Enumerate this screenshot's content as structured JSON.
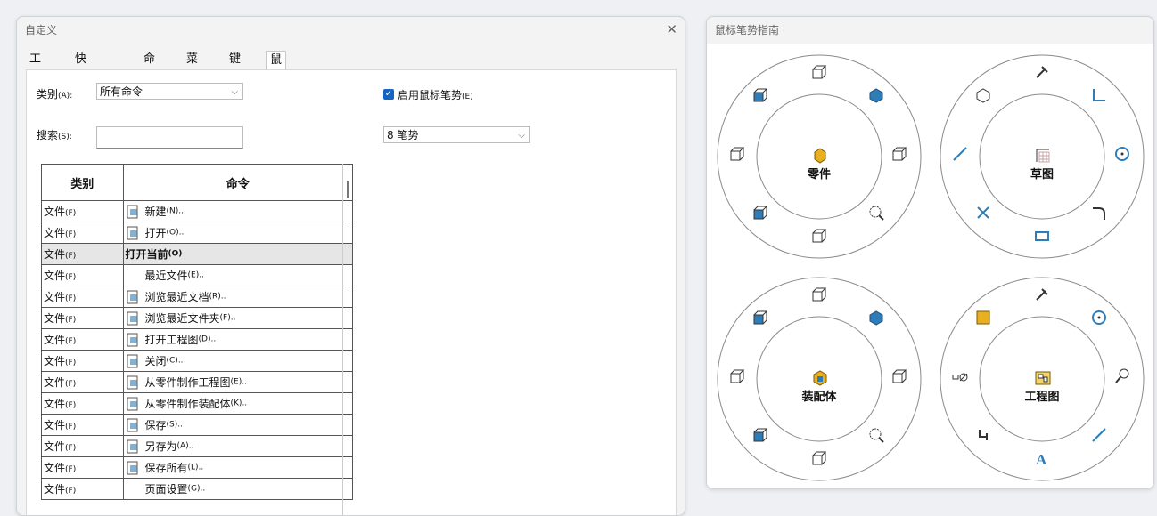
{
  "customize": {
    "title": "自定义",
    "tabs": [
      "工具栏",
      "快捷方式栏",
      "命令",
      "菜单",
      "键盘",
      "鼠标笔势"
    ],
    "category_label": "类别",
    "category_hotkey": "(A):",
    "category_value": "所有命令",
    "search_label": "搜索",
    "search_hotkey": "(S):",
    "search_value": "",
    "enable_gesture_label": "启用鼠标笔势",
    "enable_gesture_hotkey": "(E)",
    "enable_gesture_checked": true,
    "gesture_count_value": "8 笔势",
    "table": {
      "headers": [
        "类别",
        "命令"
      ],
      "rows": [
        {
          "cat": "文件",
          "cat_hk": "(F)",
          "icon": "new-document-icon",
          "cmd": "新建",
          "cmd_hk": "(N)..",
          "bold": false
        },
        {
          "cat": "文件",
          "cat_hk": "(F)",
          "icon": "open-folder-icon",
          "cmd": "打开",
          "cmd_hk": "(O)..",
          "bold": false
        },
        {
          "cat": "文件",
          "cat_hk": "(F)",
          "icon": "",
          "cmd": "打开当前",
          "cmd_hk": "(O)",
          "bold": true
        },
        {
          "cat": "文件",
          "cat_hk": "(F)",
          "icon": "",
          "cmd": "最近文件",
          "cmd_hk": "(E)..",
          "bold": false
        },
        {
          "cat": "文件",
          "cat_hk": "(F)",
          "icon": "browse-recent-docs-icon",
          "cmd": "浏览最近文档",
          "cmd_hk": "(R)..",
          "bold": false
        },
        {
          "cat": "文件",
          "cat_hk": "(F)",
          "icon": "browse-recent-folders-icon",
          "cmd": "浏览最近文件夹",
          "cmd_hk": "(F)..",
          "bold": false
        },
        {
          "cat": "文件",
          "cat_hk": "(F)",
          "icon": "open-drawing-icon",
          "cmd": "打开工程图",
          "cmd_hk": "(D)..",
          "bold": false
        },
        {
          "cat": "文件",
          "cat_hk": "(F)",
          "icon": "close-document-icon",
          "cmd": "关闭",
          "cmd_hk": "(C)..",
          "bold": false
        },
        {
          "cat": "文件",
          "cat_hk": "(F)",
          "icon": "make-drawing-icon",
          "cmd": "从零件制作工程图",
          "cmd_hk": "(E)..",
          "bold": false
        },
        {
          "cat": "文件",
          "cat_hk": "(F)",
          "icon": "make-assembly-icon",
          "cmd": "从零件制作装配体",
          "cmd_hk": "(K)..",
          "bold": false
        },
        {
          "cat": "文件",
          "cat_hk": "(F)",
          "icon": "save-icon",
          "cmd": "保存",
          "cmd_hk": "(S)..",
          "bold": false
        },
        {
          "cat": "文件",
          "cat_hk": "(F)",
          "icon": "save-as-icon",
          "cmd": "另存为",
          "cmd_hk": "(A)..",
          "bold": false
        },
        {
          "cat": "文件",
          "cat_hk": "(F)",
          "icon": "save-all-icon",
          "cmd": "保存所有",
          "cmd_hk": "(L)..",
          "bold": false
        },
        {
          "cat": "文件",
          "cat_hk": "(F)",
          "icon": "",
          "cmd": "页面设置",
          "cmd_hk": "(G)..",
          "bold": false
        }
      ]
    }
  },
  "guide": {
    "title": "鼠标笔势指南",
    "rings": [
      {
        "label": "零件",
        "center_icon": "part-icon"
      },
      {
        "label": "草图",
        "center_icon": "sketch-icon"
      },
      {
        "label": "装配体",
        "center_icon": "assembly-icon"
      },
      {
        "label": "工程图",
        "center_icon": "drawing-icon"
      }
    ]
  },
  "colors": {
    "accent": "#1565c0",
    "cube": "#2f7db8",
    "part": "#e8b020"
  }
}
